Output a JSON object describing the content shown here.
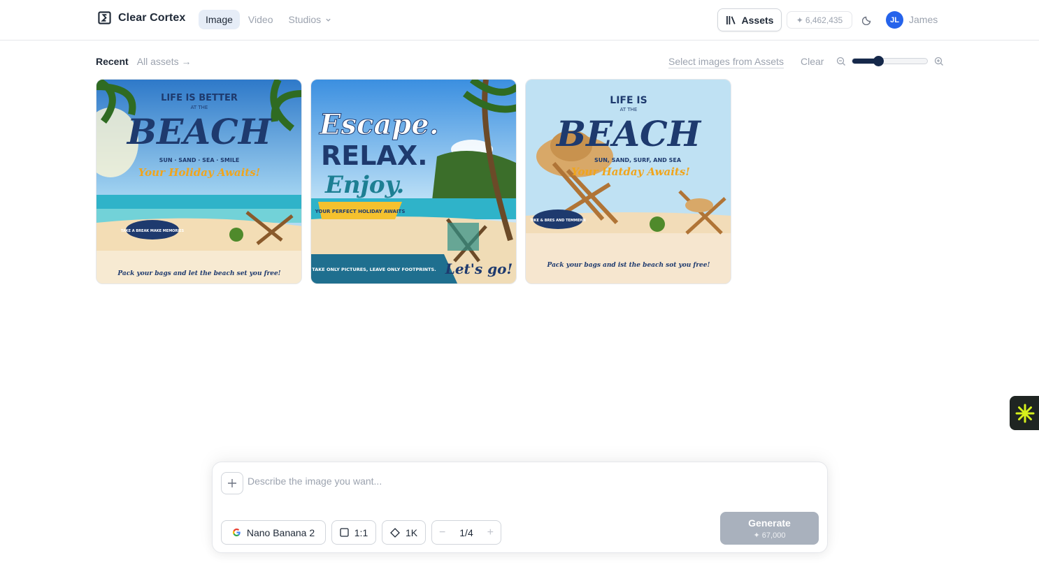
{
  "header": {
    "brand": "Clear Cortex",
    "nav": [
      {
        "label": "Image",
        "active": true
      },
      {
        "label": "Video",
        "active": false
      },
      {
        "label": "Studios",
        "active": false,
        "dropdown": true
      }
    ],
    "assets_label": "Assets",
    "credits": "6,462,435",
    "user_initials": "JL",
    "user_name": "James"
  },
  "toolbar": {
    "tab_recent": "Recent",
    "tab_all": "All assets →",
    "select_link": "Select images from Assets",
    "clear": "Clear",
    "zoom_level": 0.35
  },
  "gallery": [
    {
      "line1": "LIFE IS BETTER",
      "line2": "AT THE",
      "line3": "BEACH",
      "line4": "SUN · SAND · SEA · SMILE",
      "line5": "Your Holiday Awaits!",
      "badge": "TAKE A BREAK MAKE MEMORIES",
      "footer": "Pack your bags and let the beach set you free!"
    },
    {
      "line1": "Escape.",
      "line2": "RELAX.",
      "line3": "Enjoy.",
      "line4": "YOUR PERFECT HOLIDAY AWAITS",
      "line5": "TAKE ONLY PICTURES, LEAVE ONLY FOOTPRINTS.",
      "footer": "Let's go!"
    },
    {
      "line1": "LIFE IS",
      "line2": "AT THE",
      "line3": "BEACH",
      "line4": "SUN, SAND, SURF, AND SEA",
      "line5": "Your Hatday Awaits!",
      "badge": "TIKE & BRES AND TEMMEHN",
      "footer": "Pack your bags and ist the beach sot you free!"
    }
  ],
  "prompt": {
    "placeholder": "Describe the image you want...",
    "model": "Nano Banana 2",
    "ratio": "1:1",
    "resolution": "1K",
    "count": "1/4",
    "generate": "Generate",
    "cost": "✦ 67,000"
  }
}
